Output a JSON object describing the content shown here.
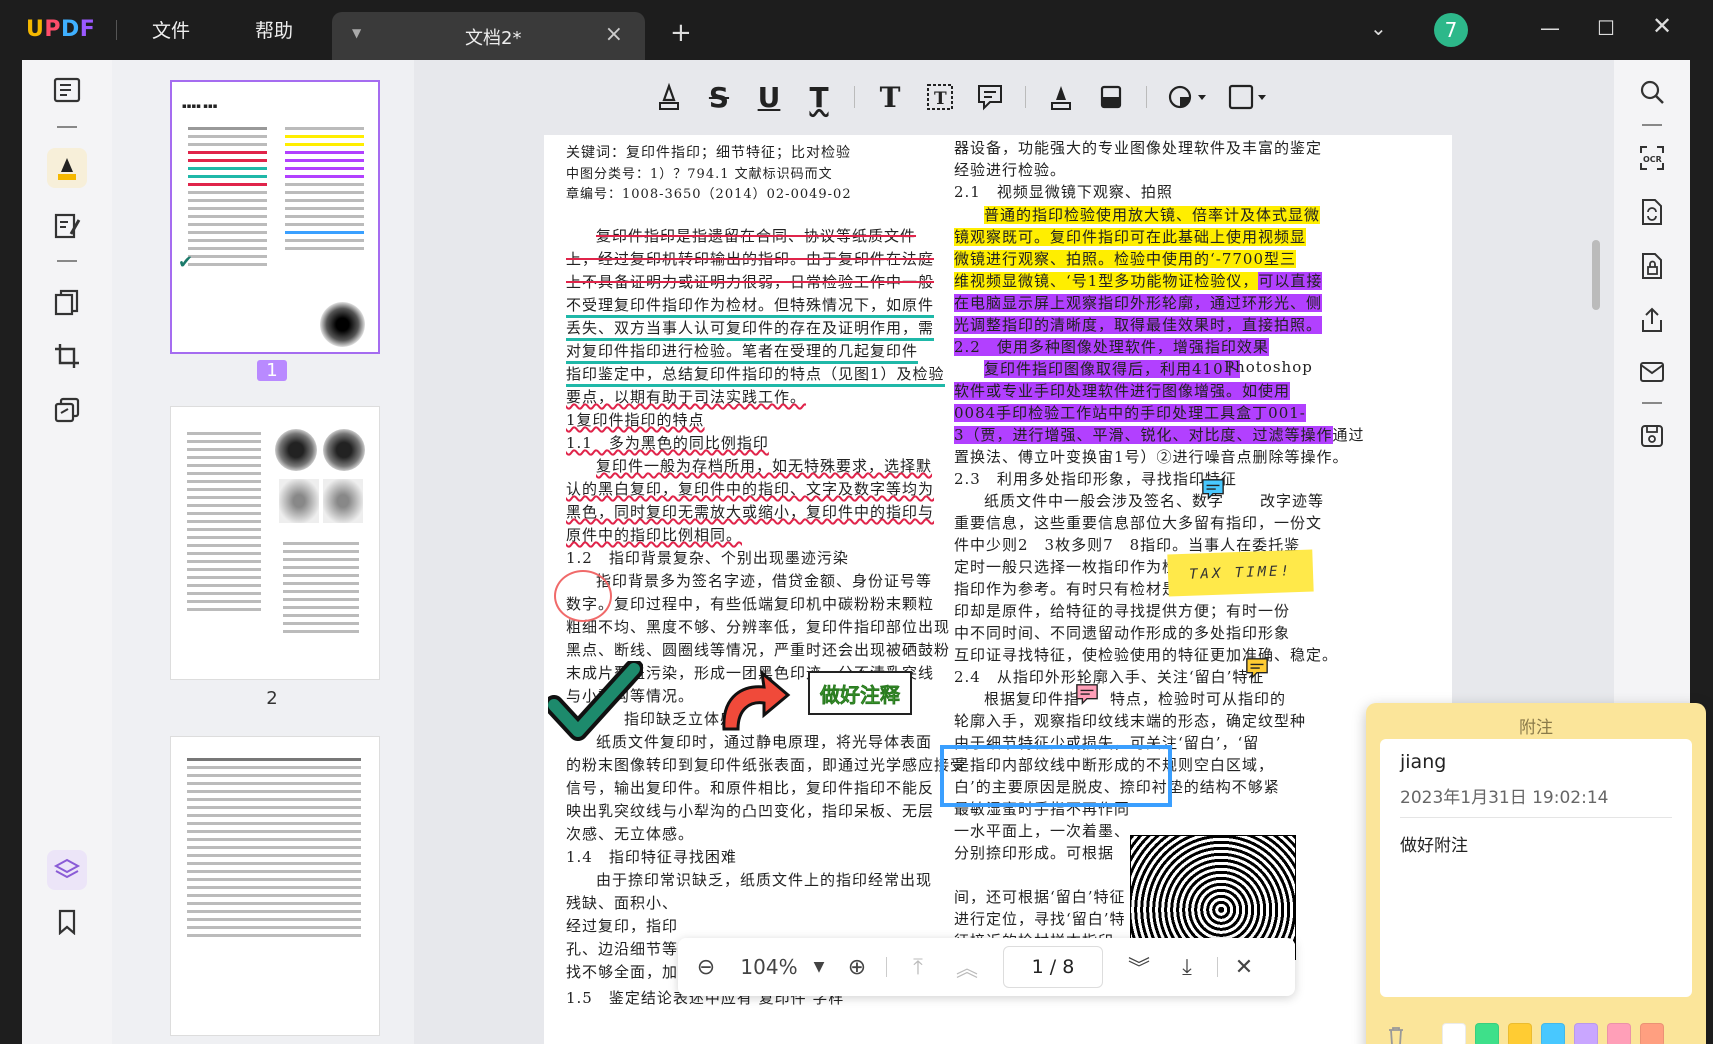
{
  "app": {
    "logo": "UPDF",
    "menu": [
      "文件",
      "帮助"
    ],
    "tab_title": "文档2*",
    "avatar_initial": "7"
  },
  "doc_left": {
    "meta": [
      "关键词：复印件指印；细节特征；比对检验",
      "中图分类号：1）？794.1 文献标识码而文",
      "章编号：1008-3650（2014）02-0049-02"
    ],
    "strike_lines": [
      "复印件指印是指遗留在合同、协议等纸质文件",
      "上，经过复印机转印输出的指印。由于复印件在法庭",
      "上不具备证明力或证明力很弱，日常检验工作中一般"
    ],
    "green_lines": [
      "不受理复印件指印作为检材。但特殊情况下，如原件",
      "丢失、双方当事人认可复印件的存在及证明作用，需",
      "对复印件指印进行检验。笔者在受理的几起复印件",
      "指印鉴定中，总结复印件指印的特点（见图1）及检验"
    ],
    "wavy_lines": [
      "要点，以期有助于司法实践工作。",
      "1复印件指印的特点",
      "1.1　多为黑色的同比例指印",
      "复印件一般为存档所用，如无特殊要求，选择默",
      "认的黑白复印，复印件中的指印、文字及数字等均为",
      "黑色，同时复印无需放大或缩小，复印件中的指印与",
      "原件中的指印比例相同。"
    ],
    "plain_lines": [
      "1.2　指印背景复杂、个别出现墨迹污染",
      "指印背景多为签名字迹，借贷金额、身份证号等",
      "数字。复印过程中，有些低端复印机中碳粉粉末颗粒",
      "粗细不均、黑度不够、分辨率低，复印件指印部位出现",
      "黑点、断线、圆圈线等情况，严重时还会出现被硒鼓粉",
      "末成片覆盖污染，形成一团黑色印迹，分不清乳突线",
      "与小犁沟等情况。",
      "指印缺乏立体感",
      "纸质文件复印时，通过静电原理，将光导体表面",
      "的粉末图像转印到复印件纸张表面，即通过光学感应接受",
      "信号，输出复印件。和原件相比，复印件指印不能反",
      "映出乳突纹线与小犁沟的凸凹变化，指印呆板、无层",
      "次感、无立体感。",
      "1.4　指印特征寻找困难",
      "由于捺印常识缺乏，纸质文件上的指印经常出现",
      "残缺、面积小、",
      "经过复印，指印",
      "孔、边沿细节等细微特征，使指印特征寻找困难，或寻",
      "找不够全面，加大检验难度。",
      "1.5　鉴定结论表述中应有‘复印件’字样"
    ],
    "callout": "做好注释"
  },
  "doc_right": {
    "lines_top": [
      "器设备，功能强大的专业图像处理软件及丰富的鉴定",
      "经验进行检验。",
      "2.1　视频显微镜下观察、拍照"
    ],
    "yellow_lines": [
      "普通的指印检验使用放大镜、倍率计及体式显微",
      "镜观察既可。复印件指印可在此基础上使用视频显",
      "微镜进行观察、拍照。检验中使用的‘-7700型三",
      "维视频显微镜、‘号1型多功能物证检验仪，"
    ],
    "purple_tail": "可以直接",
    "purple_lines": [
      "在电脑显示屏上观察指印外形轮廓，通过环形光、侧",
      "光调整指印的清晰度，取得最佳效果时，直接拍照。",
      "2.2　使用多种图像处理软件，增强指印效果",
      "复印件指印图像取得后，利用410卜"
    ],
    "photoshop": "Photoshop",
    "purple_lines2": [
      "软件或专业手印处理软件进行图像增强。如使用",
      "0084手印检验工作站中的手印处理工具盒丁001-",
      "3（贾，进行增强、平滑、锐化、对比度、过滤等操作"
    ],
    "purple_tail2": "通过",
    "lines_mid": [
      "置换法、傅立叶变换宙1号）②进行噪音点删除等操作。",
      "2.3　利用多处指印形象，寻找指印特征",
      "纸质文件中一般会涉及签名、数字",
      "重要信息，这些重要信息部位大多留有指印，一份文",
      "件中少则2　3枚多则7　8指印。当事人在委托鉴",
      "定时一般只选择一枚指印作为检材",
      "指印作为参考。有时只有检材是复",
      "印却是原件，给特征的寻找提供方便；有时一份",
      "中不同时间、不同遗留动作形成的多处指印形象",
      "互印证寻找特征，使检验使用的特征更加准确、稳定。",
      "2.4　从指印外形轮廓入手、关注‘留白’特征",
      "根据复印件指",
      "轮廓入手，观察指印纹线末端的形态，确定纹型种",
      "由于细节特征少或损失，可关注‘留白’，‘留",
      "是指印内部纹线中断形成的不规则空白区域，",
      "白’的主要原因是脱皮、捺印衬垫的结构不够紧",
      "最敏湿蜜时手指不再作同",
      "一水平面上，一次着墨、",
      "分别捺印形成。可根据",
      "间，还可根据‘留白’特征",
      "进行定位，寻找‘留白’特",
      "征接近的检材样本指印。"
    ],
    "part_suffix_a": "改字迹等",
    "part_suffix_b": "特点，检验时可从指印的",
    "sticky": "TAX TIME!"
  },
  "zoom": "104%",
  "page_indicator": "1 / 8",
  "page_numbers": [
    "1",
    "2"
  ],
  "note": {
    "title": "附注",
    "author": "jiang",
    "date": "2023年1月31日 19:02:14",
    "body": "做好附注",
    "swatches": [
      "#ffffff",
      "#3ee08a",
      "#ffcc33",
      "#48c8ff",
      "#c9a6ff",
      "#ff9fb8",
      "#ff9f80"
    ]
  }
}
